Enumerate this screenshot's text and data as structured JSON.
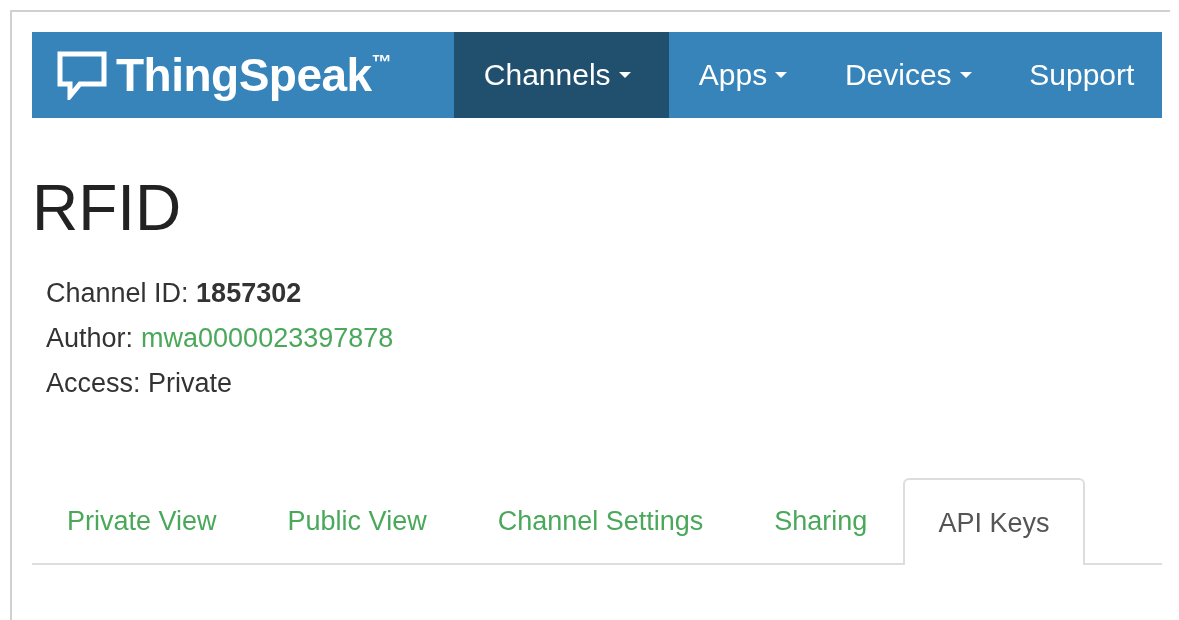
{
  "navbar": {
    "brand": "ThingSpeak$^{™}$",
    "items": [
      {
        "label": "Channels",
        "has_caret": true,
        "selected": true
      },
      {
        "label": "Apps",
        "has_caret": true,
        "selected": false
      },
      {
        "label": "Devices",
        "has_caret": true,
        "selected": false
      },
      {
        "label": "Support",
        "has_caret": false,
        "selected": false
      }
    ]
  },
  "channel": {
    "title": "RFID",
    "id_line": "Channel ID: **1857302**",
    "author_label": "Author:",
    "author": "mwa0000023397878",
    "access": "Access: Private"
  },
  "tabs": [
    {
      "label": "Private View",
      "selected": false
    },
    {
      "label": "Public View",
      "selected": false
    },
    {
      "label": "Channel Settings",
      "selected": false
    },
    {
      "label": "Sharing",
      "selected": false
    },
    {
      "label": "API Keys",
      "selected": true
    }
  ]
}
